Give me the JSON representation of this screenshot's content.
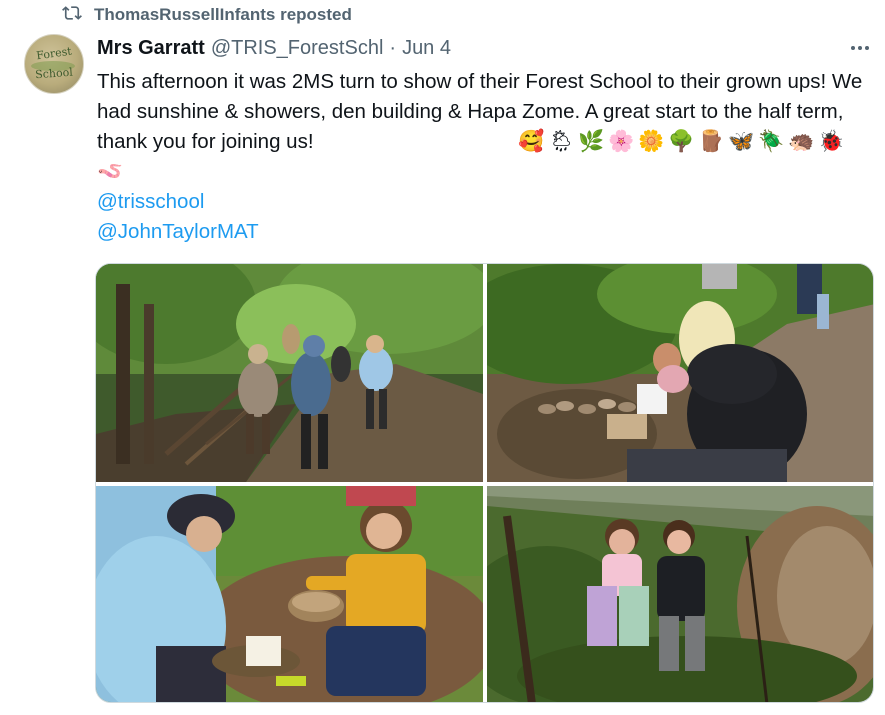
{
  "repost": {
    "label": "ThomasRussellInfants reposted",
    "icon": "repost-icon"
  },
  "author": {
    "name": "Mrs Garratt",
    "handle": "@TRIS_ForestSchl",
    "separator": "·",
    "date": "Jun 4",
    "avatar_text_top": "Forest",
    "avatar_text_bottom": "School"
  },
  "tweet": {
    "text": "This afternoon it was 2MS turn to show of their Forest School to their grown ups! We had sunshine & showers, den building & Hapa Zome. A great start to the half term, thank you for joining us!",
    "emojis": [
      "🥰",
      "🌦",
      "🌿",
      "🌸",
      "🌼",
      "🌳",
      "🪵",
      "🦋",
      "🪲",
      "🦔",
      "🐞"
    ],
    "emoji_line2": "🪱",
    "mentions": [
      "@trisschool",
      "@JohnTaylorMAT"
    ]
  },
  "media": {
    "photos": [
      {
        "alt": "forest-path-children-photo"
      },
      {
        "alt": "hapa-zome-leaves-photo"
      },
      {
        "alt": "boy-and-parent-stump-photo"
      },
      {
        "alt": "girls-in-den-photo"
      }
    ]
  },
  "colors": {
    "link": "#1d9bf0",
    "muted": "#536471",
    "text": "#0f1419",
    "border": "#cfd9de"
  },
  "icons": [
    "repost-icon",
    "more-icon"
  ]
}
